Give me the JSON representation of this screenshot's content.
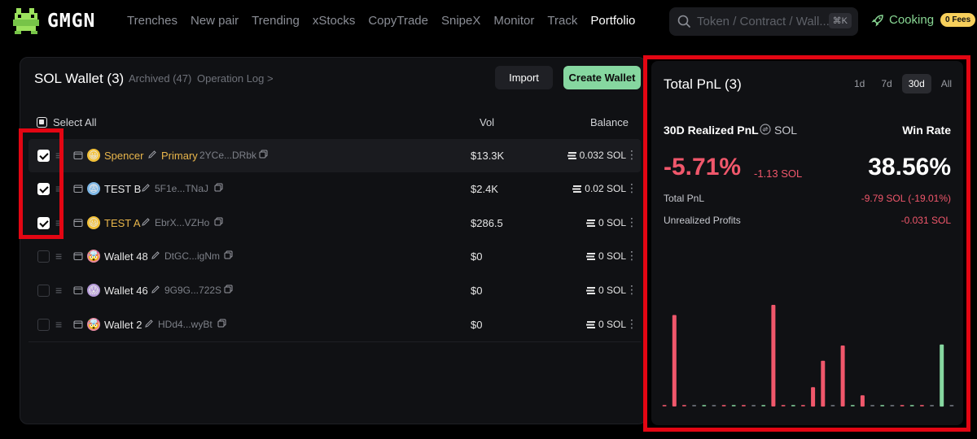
{
  "nav": {
    "logo_text": "GMGN",
    "links": [
      "Trenches",
      "New pair",
      "Trending",
      "xStocks",
      "CopyTrade",
      "SnipeX",
      "Monitor",
      "Track",
      "Portfolio"
    ],
    "active": "Portfolio",
    "search_placeholder": "Token / Contract / Wall...",
    "search_shortcut": "⌘K",
    "cooking_label": "Cooking",
    "fees_badge": "0 Fees"
  },
  "wallets": {
    "title": "SOL Wallet (3)",
    "archived": "Archived (47)",
    "operation_log": "Operation Log >",
    "import_label": "Import",
    "create_label": "Create Wallet",
    "select_all": "Select All",
    "col_vol": "Vol",
    "col_balance": "Balance",
    "rows": [
      {
        "name": "Spencer",
        "tag": "Primary",
        "address": "2YCe...DRbk",
        "vol": "$13.3K",
        "balance": "0.032 SOL",
        "checked": true,
        "highlight": true,
        "gold": true,
        "avatar": "😀",
        "avatar_bg": "#f3c13a"
      },
      {
        "name": "TEST B",
        "tag": "",
        "address": "5F1e...TNaJ",
        "vol": "$2.4K",
        "balance": "0.02 SOL",
        "checked": true,
        "highlight": false,
        "gold": false,
        "avatar": "😨",
        "avatar_bg": "#7fb9e8"
      },
      {
        "name": "TEST A",
        "tag": "",
        "address": "EbrX...VZHo",
        "vol": "$286.5",
        "balance": "0 SOL",
        "checked": true,
        "highlight": false,
        "gold": true,
        "avatar": "😃",
        "avatar_bg": "#f3c13a"
      },
      {
        "name": "Wallet 48",
        "tag": "",
        "address": "DtGC...igNm",
        "vol": "$0",
        "balance": "0 SOL",
        "checked": false,
        "highlight": false,
        "gold": false,
        "avatar": "🤯",
        "avatar_bg": "#e88aa0"
      },
      {
        "name": "Wallet 46",
        "tag": "",
        "address": "9G9G...722S",
        "vol": "$0",
        "balance": "0 SOL",
        "checked": false,
        "highlight": false,
        "gold": false,
        "avatar": "😱",
        "avatar_bg": "#b59ad9"
      },
      {
        "name": "Wallet 2",
        "tag": "",
        "address": "HDd4...wyBt",
        "vol": "$0",
        "balance": "0 SOL",
        "checked": false,
        "highlight": false,
        "gold": false,
        "avatar": "🤯",
        "avatar_bg": "#e88aa0"
      }
    ]
  },
  "pnl": {
    "title": "Total PnL (3)",
    "periods": [
      "1d",
      "7d",
      "30d",
      "All"
    ],
    "active_period": "30d",
    "realized_label": "30D Realized PnL",
    "currency": "SOL",
    "winrate_label": "Win Rate",
    "realized_pct": "-5.71%",
    "realized_sol": "-1.13 SOL",
    "winrate": "38.56%",
    "total_pnl_label": "Total PnL",
    "total_pnl_value": "-9.79 SOL (-19.01%)",
    "unrealized_label": "Unrealized Profits",
    "unrealized_value": "-0.031 SOL"
  },
  "colors": {
    "loss": "#f0576b",
    "gain": "#86d7a0",
    "accent": "#86d7a0",
    "annotation": "#e30613"
  },
  "chart_data": {
    "type": "bar",
    "title": "",
    "xlabel": "",
    "ylabel": "",
    "values": [
      0,
      -0.9,
      0,
      0,
      0,
      0,
      0,
      0,
      0,
      0,
      0,
      -1,
      0,
      0,
      0,
      -0.19,
      -0.45,
      0,
      -0.6,
      0,
      -0.11,
      0,
      0,
      0,
      0,
      0,
      0,
      0,
      0.61,
      0
    ],
    "ylim": [
      0,
      1
    ],
    "grid": false,
    "legend": "none"
  }
}
